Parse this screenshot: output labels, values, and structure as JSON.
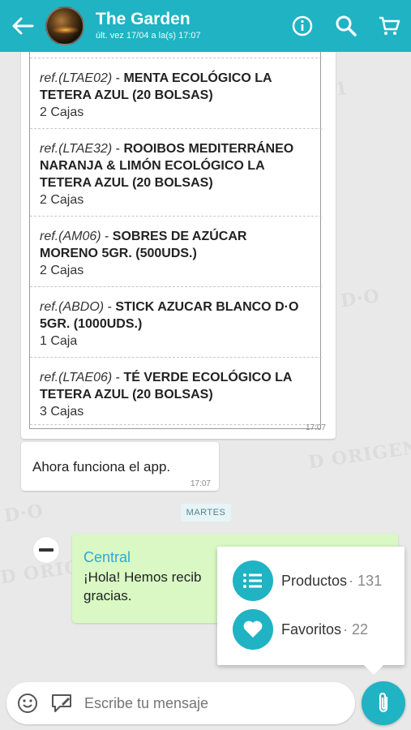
{
  "header": {
    "title": "The Garden",
    "subtitle": "últ. vez 17/04 a la(s) 17:07"
  },
  "order": {
    "items": [
      {
        "ref": "ref.(LTAE02)",
        "lines": [
          "MENTA ECOLÓGICO LA",
          "TETERA AZUL (20 BOLSAS)"
        ],
        "qty": "2 Cajas"
      },
      {
        "ref": "ref.(LTAE32)",
        "lines": [
          "ROOIBOS MEDITERRÁNEO",
          "NARANJA & LIMÓN ECOLÓGICO LA",
          "TETERA AZUL (20 BOLSAS)"
        ],
        "qty": "2 Cajas"
      },
      {
        "ref": "ref.(AM06)",
        "lines": [
          "SOBRES DE AZÚCAR",
          "MORENO 5GR. (500UDS.)"
        ],
        "qty": "2 Cajas"
      },
      {
        "ref": "ref.(ABDO)",
        "lines": [
          "STICK AZUCAR BLANCO D·O",
          "5GR. (1000UDS.)"
        ],
        "qty": "1 Caja"
      },
      {
        "ref": "ref.(LTAE06)",
        "lines": [
          "TÉ VERDE ECOLÓGICO LA",
          "TETERA AZUL (20 BOLSAS)"
        ],
        "qty": "3 Cajas"
      }
    ],
    "time": "17:07"
  },
  "incoming": {
    "text": "Ahora funciona el app.",
    "time": "17:07"
  },
  "day_label": "MARTES",
  "outgoing": {
    "sender": "Central",
    "text": "¡Hola! Hemos recib",
    "text2": "gracias."
  },
  "popup": {
    "products_label": "Productos",
    "products_count": "· 131",
    "favorites_label": "Favoritos",
    "favorites_count": "· 22"
  },
  "composer": {
    "placeholder": "Escribe tu mensaje"
  },
  "colors": {
    "accent": "#1fb3c4",
    "outgoing": "#d9f8c4"
  }
}
